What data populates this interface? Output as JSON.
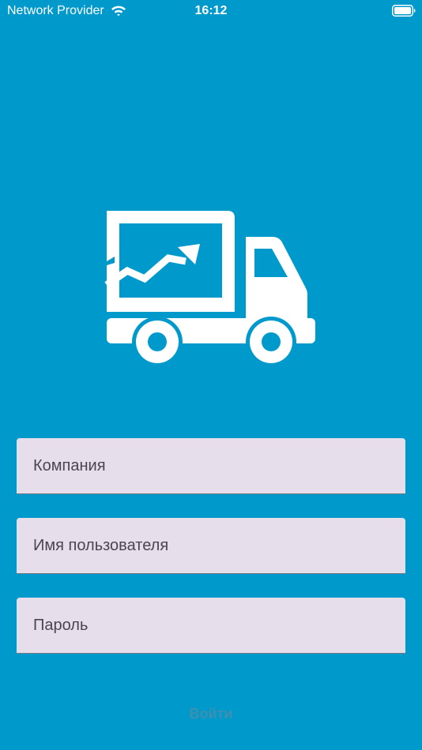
{
  "status_bar": {
    "carrier": "Network Provider",
    "time": "16:12"
  },
  "logo": {
    "icon": "delivery-truck-chart-icon",
    "color": "#ffffff"
  },
  "form": {
    "company_placeholder": "Компания",
    "username_placeholder": "Имя пользователя",
    "password_placeholder": "Пароль",
    "company_value": "",
    "username_value": "",
    "password_value": ""
  },
  "login_button": {
    "label": "Войти"
  },
  "colors": {
    "background": "#0099cc",
    "field_background": "#e6dfeb",
    "button_text": "#3e8fb0"
  }
}
